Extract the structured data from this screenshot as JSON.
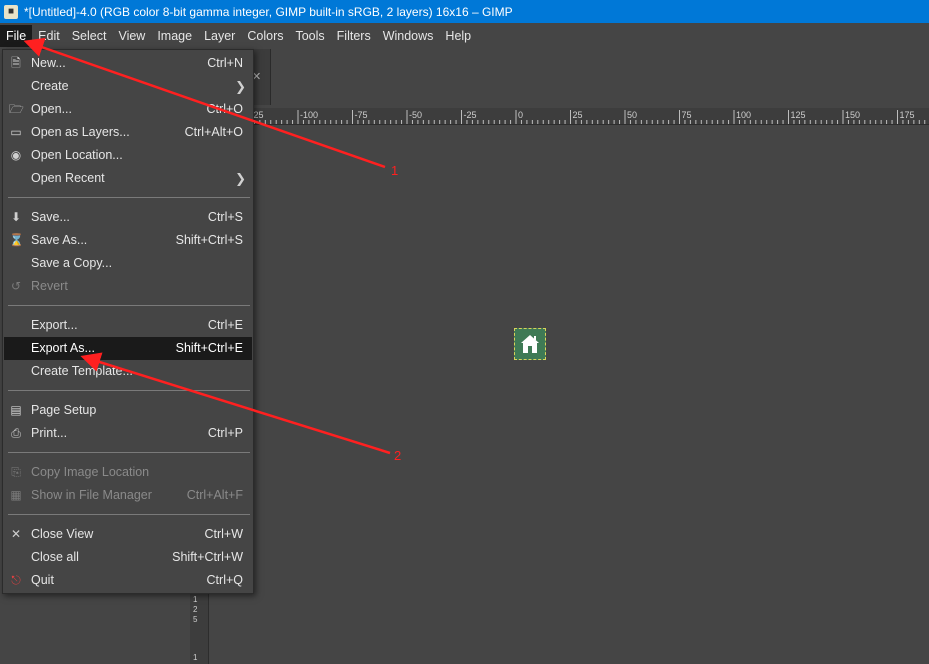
{
  "window": {
    "title": "*[Untitled]-4.0 (RGB color 8-bit gamma integer, GIMP built-in sRGB, 2 layers) 16x16 – GIMP"
  },
  "menubar": {
    "items": [
      "File",
      "Edit",
      "Select",
      "View",
      "Image",
      "Layer",
      "Colors",
      "Tools",
      "Filters",
      "Windows",
      "Help"
    ]
  },
  "ruler": {
    "ticks": [
      "-125",
      "-100",
      "-75",
      "-50",
      "-25",
      "0",
      "25",
      "50",
      "75",
      "100",
      "125",
      "150",
      "175"
    ],
    "left_ticks": [
      "1",
      "2",
      "5",
      "1",
      "5"
    ]
  },
  "file_menu": {
    "items": [
      {
        "label": "New...",
        "shortcut": "Ctrl+N",
        "icon": "new-file-icon"
      },
      {
        "label": "Create",
        "shortcut": "",
        "submenu": true
      },
      {
        "label": "Open...",
        "shortcut": "Ctrl+O",
        "icon": "open-folder-icon"
      },
      {
        "label": "Open as Layers...",
        "shortcut": "Ctrl+Alt+O",
        "icon": "open-layers-icon"
      },
      {
        "label": "Open Location...",
        "shortcut": "",
        "icon": "globe-icon"
      },
      {
        "label": "Open Recent",
        "shortcut": "",
        "submenu": true
      },
      {
        "label": "Save...",
        "shortcut": "Ctrl+S",
        "icon": "save-icon"
      },
      {
        "label": "Save As...",
        "shortcut": "Shift+Ctrl+S",
        "icon": "save-as-icon"
      },
      {
        "label": "Save a Copy...",
        "shortcut": ""
      },
      {
        "label": "Revert",
        "shortcut": "",
        "icon": "revert-icon",
        "disabled": true
      },
      {
        "label": "Export...",
        "shortcut": "Ctrl+E"
      },
      {
        "label": "Export As...",
        "shortcut": "Shift+Ctrl+E",
        "highlight": true
      },
      {
        "label": "Create Template...",
        "shortcut": ""
      },
      {
        "label": "Page Setup",
        "shortcut": "",
        "icon": "page-setup-icon"
      },
      {
        "label": "Print...",
        "shortcut": "Ctrl+P",
        "icon": "printer-icon"
      },
      {
        "label": "Copy Image Location",
        "shortcut": "",
        "icon": "copy-location-icon",
        "disabled": true
      },
      {
        "label": "Show in File Manager",
        "shortcut": "Ctrl+Alt+F",
        "icon": "file-manager-icon",
        "disabled": true
      },
      {
        "label": "Close View",
        "shortcut": "Ctrl+W",
        "icon": "close-icon"
      },
      {
        "label": "Close all",
        "shortcut": "Shift+Ctrl+W"
      },
      {
        "label": "Quit",
        "shortcut": "Ctrl+Q",
        "icon": "quit-icon"
      }
    ]
  },
  "annotations": {
    "label_1": "1",
    "label_2": "2",
    "color": "#ff2020"
  },
  "colors": {
    "titlebar": "#0078d7",
    "background": "#454545",
    "highlight": "#1a1a1a"
  }
}
